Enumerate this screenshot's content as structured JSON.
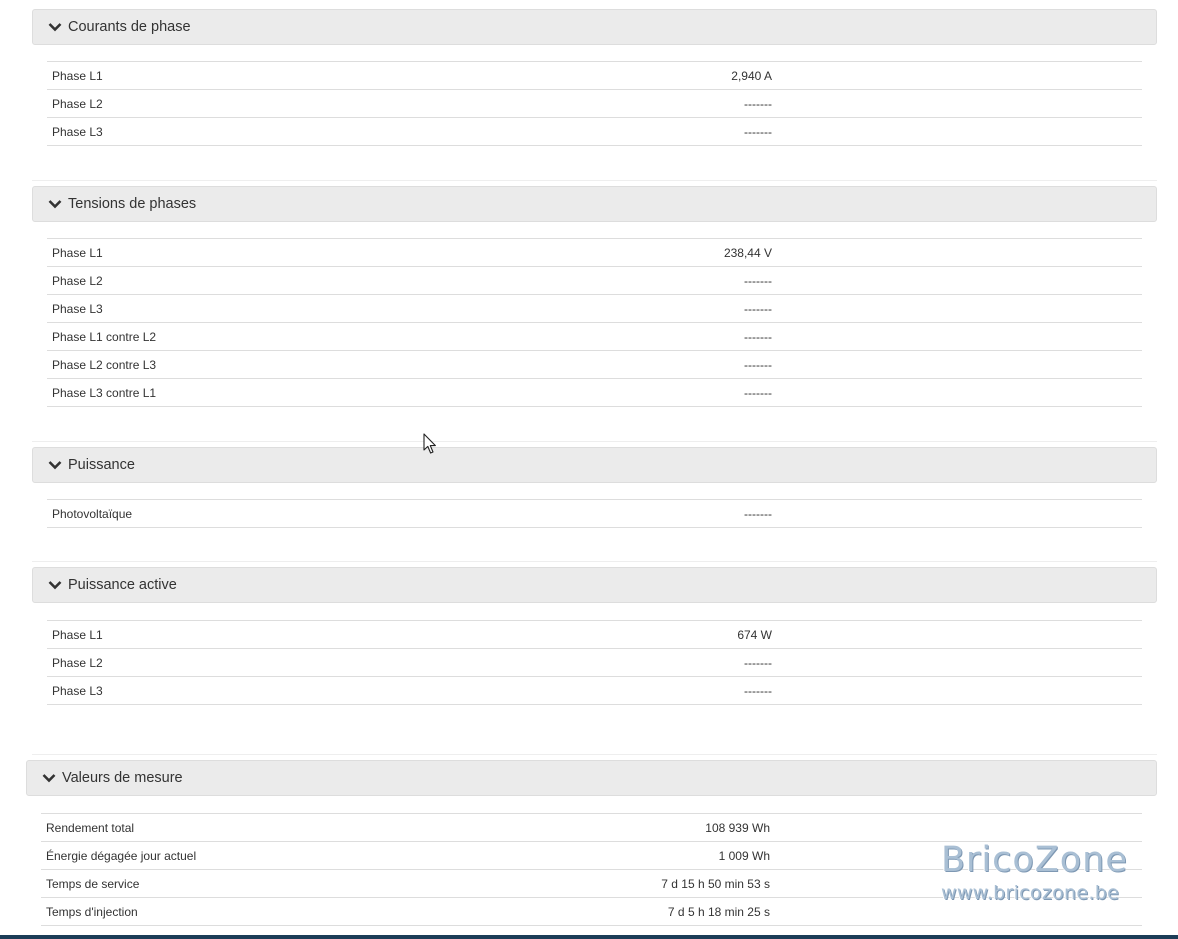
{
  "sections": [
    {
      "title": "Courants de phase",
      "rows": [
        {
          "label": "Phase L1",
          "value": "2,940 A"
        },
        {
          "label": "Phase L2",
          "value": "-------"
        },
        {
          "label": "Phase L3",
          "value": "-------"
        }
      ]
    },
    {
      "title": "Tensions de phases",
      "rows": [
        {
          "label": "Phase L1",
          "value": "238,44 V"
        },
        {
          "label": "Phase L2",
          "value": "-------"
        },
        {
          "label": "Phase L3",
          "value": "-------"
        },
        {
          "label": "Phase L1 contre L2",
          "value": "-------"
        },
        {
          "label": "Phase L2 contre L3",
          "value": "-------"
        },
        {
          "label": "Phase L3 contre L1",
          "value": "-------"
        }
      ]
    },
    {
      "title": "Puissance",
      "rows": [
        {
          "label": "Photovoltaïque",
          "value": "-------"
        }
      ]
    },
    {
      "title": "Puissance active",
      "rows": [
        {
          "label": "Phase L1",
          "value": "674 W"
        },
        {
          "label": "Phase L2",
          "value": "-------"
        },
        {
          "label": "Phase L3",
          "value": "-------"
        }
      ]
    },
    {
      "title": "Valeurs de mesure",
      "rows": [
        {
          "label": "Rendement total",
          "value": "108 939 Wh"
        },
        {
          "label": "Énergie dégagée jour actuel",
          "value": "1 009 Wh"
        },
        {
          "label": "Temps de service",
          "value": "7 d 15 h 50 min 53 s"
        },
        {
          "label": "Temps d'injection",
          "value": "7 d 5 h 18 min 25 s"
        }
      ]
    }
  ],
  "watermark": {
    "brand": "BricoZone",
    "url": "www.bricozone.be"
  },
  "icons": {
    "section_toggle": "chevron-down-icon",
    "cursor": "mouse-pointer-icon"
  },
  "colors": {
    "header_bg": "#ebebeb",
    "border": "#dddddd",
    "text": "#333333",
    "bottom_bar": "#1c3d57",
    "watermark": "#a9bfd4"
  }
}
